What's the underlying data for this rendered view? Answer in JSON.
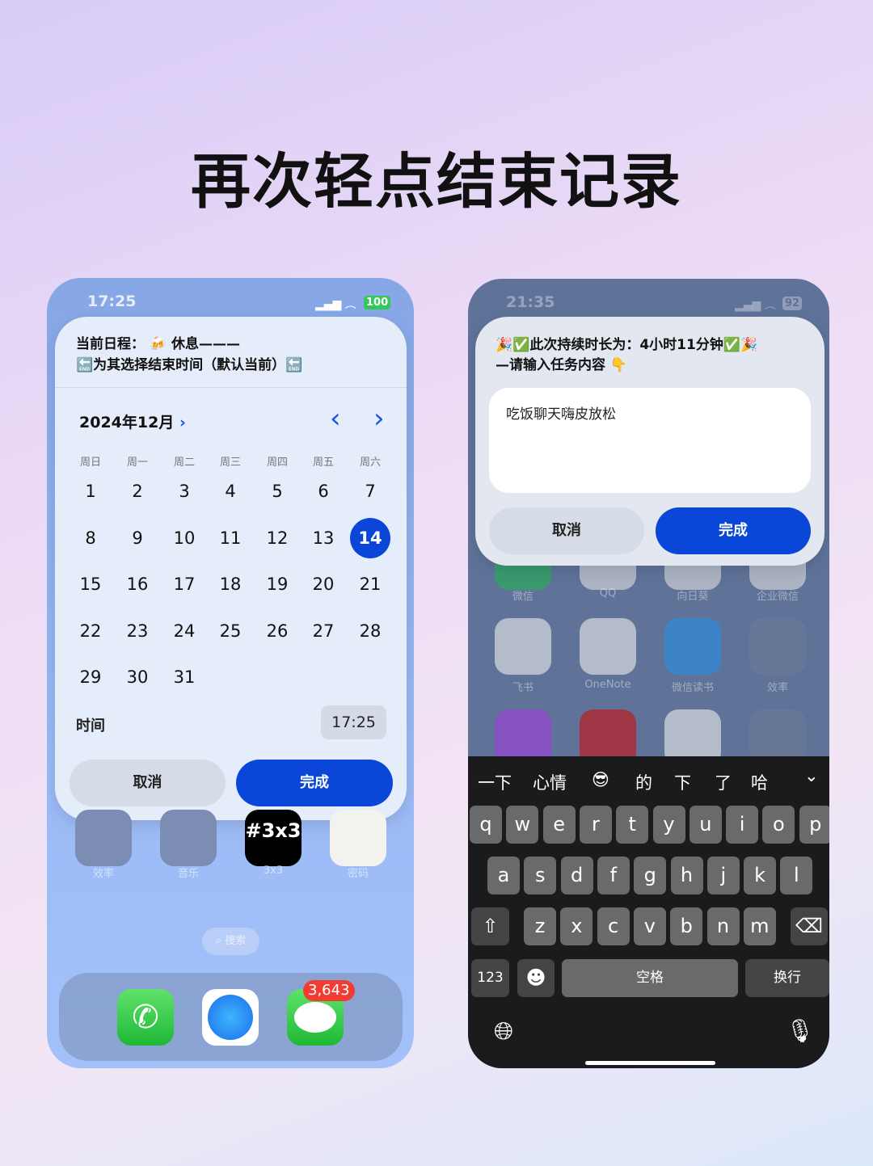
{
  "title": "再次轻点结束记录",
  "left": {
    "status": {
      "time": "17:25",
      "battery": "100"
    },
    "header": {
      "line1": "当前日程： 🍻 休息———",
      "line2": "🔚为其选择结束时间（默认当前）🔚"
    },
    "calendar": {
      "month_label": "2024年12月",
      "weekdays": [
        "周日",
        "周一",
        "周二",
        "周三",
        "周四",
        "周五",
        "周六"
      ],
      "days": [
        "1",
        "2",
        "3",
        "4",
        "5",
        "6",
        "7",
        "8",
        "9",
        "10",
        "11",
        "12",
        "13",
        "14",
        "15",
        "16",
        "17",
        "18",
        "19",
        "20",
        "21",
        "22",
        "23",
        "24",
        "25",
        "26",
        "27",
        "28",
        "29",
        "30",
        "31"
      ],
      "selected": "14"
    },
    "time_label": "时间",
    "time_value": "17:25",
    "cancel": "取消",
    "done": "完成",
    "apps": [
      {
        "label": "效率"
      },
      {
        "label": "音乐"
      },
      {
        "label": "3x3",
        "text": "#3x3"
      },
      {
        "label": "密码"
      }
    ],
    "search": "搜索",
    "dock": [
      {
        "icon": "phone-icon"
      },
      {
        "icon": "safari-icon"
      },
      {
        "icon": "messages-icon",
        "badge": "3,643"
      }
    ],
    "colors": {
      "accent": "#0a47d9"
    }
  },
  "right": {
    "status": {
      "time": "21:35",
      "battery": "92"
    },
    "header": {
      "line1": "🎉✅此次持续时长为：4小时11分钟✅🎉",
      "line2": "—请输入任务内容 👇"
    },
    "input_value": "吃饭聊天嗨皮放松",
    "cancel": "取消",
    "done": "完成",
    "apps_row1": [
      "微信",
      "QQ",
      "向日葵",
      "企业微信"
    ],
    "apps_row2": [
      "飞书",
      "OneNote",
      "微信读书",
      "效率"
    ],
    "keyboard": {
      "suggestions": [
        "一下",
        "心情",
        "😎",
        "的",
        "下",
        "了",
        "哈"
      ],
      "row1": [
        "q",
        "w",
        "e",
        "r",
        "t",
        "y",
        "u",
        "i",
        "o",
        "p"
      ],
      "row2": [
        "a",
        "s",
        "d",
        "f",
        "g",
        "h",
        "j",
        "k",
        "l"
      ],
      "row3": [
        "z",
        "x",
        "c",
        "v",
        "b",
        "n",
        "m"
      ],
      "numbers": "123",
      "space": "空格",
      "return": "换行"
    }
  }
}
